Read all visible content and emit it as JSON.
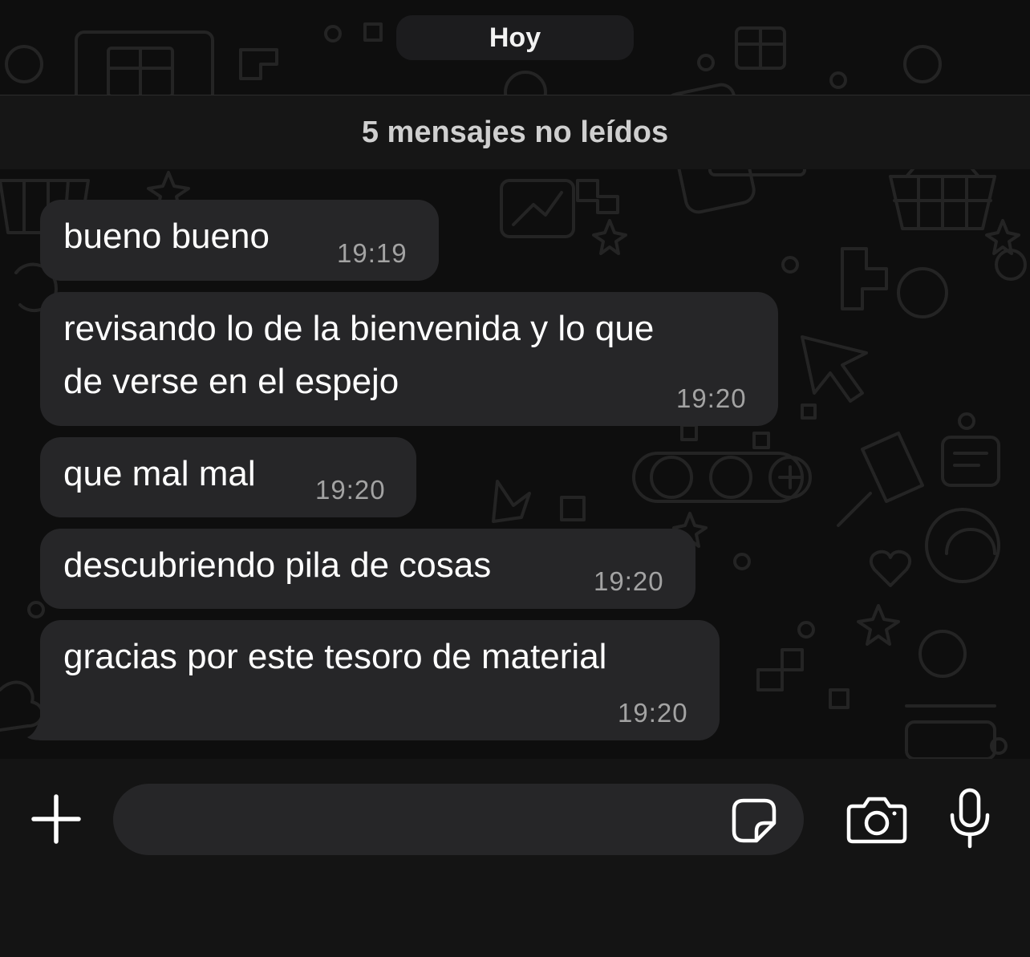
{
  "chat": {
    "date_label": "Hoy",
    "unread_label": "5 mensajes no leídos",
    "messages": [
      {
        "lines": [
          "bueno bueno"
        ],
        "time": "19:19"
      },
      {
        "lines": [
          "revisando lo de la bienvenida y lo que",
          "de verse en el espejo"
        ],
        "time": "19:20"
      },
      {
        "lines": [
          "que mal mal"
        ],
        "time": "19:20"
      },
      {
        "lines": [
          "descubriendo pila de cosas"
        ],
        "time": "19:20"
      },
      {
        "lines": [
          "gracias por este tesoro de material"
        ],
        "time": "19:20"
      }
    ]
  },
  "composer": {
    "input_value": "",
    "icons": {
      "attach": "plus-icon",
      "sticker": "sticker-icon",
      "camera": "camera-icon",
      "voice": "microphone-icon"
    }
  },
  "colors": {
    "background": "#0e0e0e",
    "bubble": "#262628",
    "timestamp": "#a3a3a3",
    "banner": "#161616",
    "composer": "#141414"
  }
}
